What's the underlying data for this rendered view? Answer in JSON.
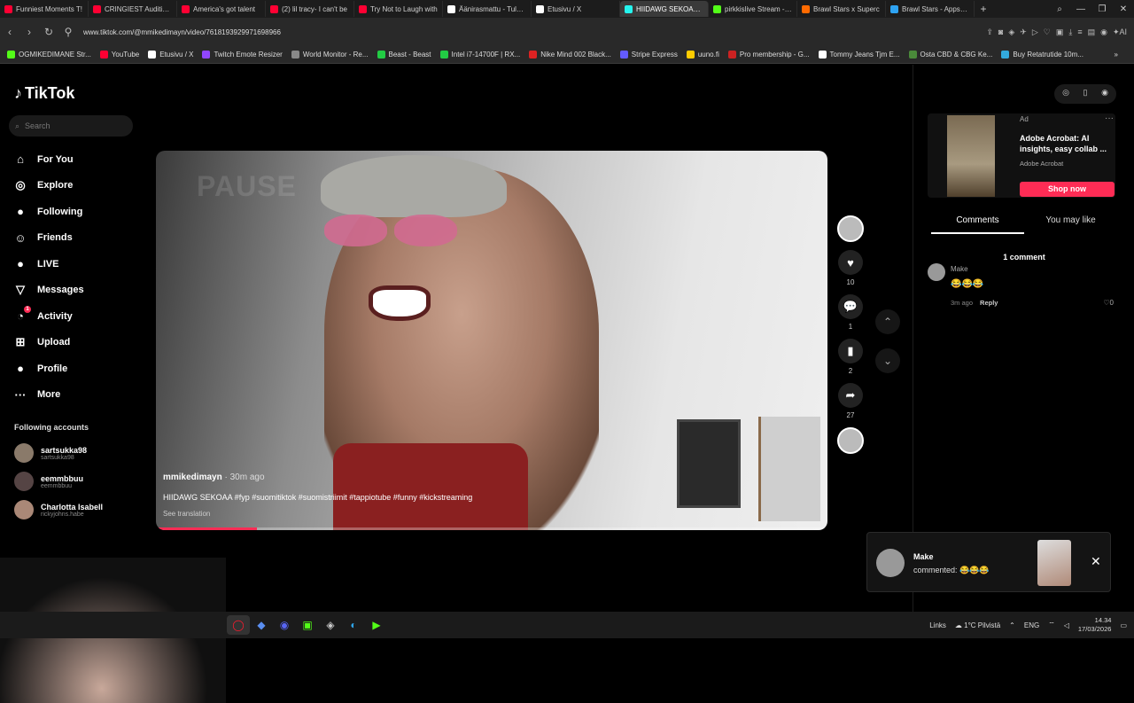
{
  "browser": {
    "tabs": [
      {
        "label": "Funniest Moments T!",
        "color": "#ff0033",
        "active": false
      },
      {
        "label": "CRINGIEST Auditions",
        "color": "#ff0033",
        "active": false
      },
      {
        "label": "America's got talent",
        "color": "#ff0033",
        "active": false
      },
      {
        "label": "(2) lil tracy- I can't be",
        "color": "#ff0033",
        "active": false
      },
      {
        "label": "Try Not to Laugh with",
        "color": "#ff0033",
        "active": false
      },
      {
        "label": "Äänirasmattu - Tule u",
        "color": "#ffffff",
        "active": false
      },
      {
        "label": "Etusivu / X",
        "color": "#ffffff",
        "active": false
      },
      {
        "label": "HIIDAWG SEKOAA #",
        "color": "#25f4ee",
        "active": true
      },
      {
        "label": "pirkkislive Stream - W",
        "color": "#53fc18",
        "active": false
      },
      {
        "label": "Brawl Stars x Superc",
        "color": "#ff6a00",
        "active": false
      },
      {
        "label": "Brawl Stars - Apps on",
        "color": "#2ea3f2",
        "active": false
      }
    ],
    "url": "www.tiktok.com/@mmikedimayn/video/7618193929971698966",
    "bookmarks": [
      {
        "label": "OGMIKEDIMANE Str...",
        "color": "#53fc18"
      },
      {
        "label": "YouTube",
        "color": "#ff0033"
      },
      {
        "label": "Etusivu / X",
        "color": "#ffffff"
      },
      {
        "label": "Twitch Emote Resizer",
        "color": "#9146ff"
      },
      {
        "label": "World Monitor - Re...",
        "color": "#888888"
      },
      {
        "label": "Beast - Beast",
        "color": "#22cc44"
      },
      {
        "label": "Intel i7-14700F | RX...",
        "color": "#22cc44"
      },
      {
        "label": "Nike Mind 002 Black...",
        "color": "#dd2222"
      },
      {
        "label": "Stripe Express",
        "color": "#635bff"
      },
      {
        "label": "uuno.fi",
        "color": "#ffcc00"
      },
      {
        "label": "Pro membership - G...",
        "color": "#cc2222"
      },
      {
        "label": "Tommy Jeans Tjm E...",
        "color": "#ffffff"
      },
      {
        "label": "Osta CBD & CBG Ke...",
        "color": "#4a8a3a"
      },
      {
        "label": "Buy Retatrutide 10m...",
        "color": "#33aadd"
      }
    ]
  },
  "tiktok": {
    "logo": "TikTok",
    "search_placeholder": "Search",
    "menu": [
      {
        "label": "For You",
        "icon": "home-icon",
        "glyph": "⌂"
      },
      {
        "label": "Explore",
        "icon": "compass-icon",
        "glyph": "◎"
      },
      {
        "label": "Following",
        "icon": "following-icon",
        "glyph": "●"
      },
      {
        "label": "Friends",
        "icon": "friends-icon",
        "glyph": "☺"
      },
      {
        "label": "LIVE",
        "icon": "live-icon",
        "glyph": "●"
      },
      {
        "label": "Messages",
        "icon": "messages-icon",
        "glyph": "▽"
      },
      {
        "label": "Activity",
        "icon": "activity-icon",
        "glyph": "◔",
        "badge": "1"
      },
      {
        "label": "Upload",
        "icon": "upload-icon",
        "glyph": "⊞"
      },
      {
        "label": "Profile",
        "icon": "profile-icon",
        "glyph": "●"
      },
      {
        "label": "More",
        "icon": "more-icon",
        "glyph": "···"
      }
    ],
    "following_title": "Following accounts",
    "following": [
      {
        "name": "sartsukka98",
        "handle": "sartsukka98"
      },
      {
        "name": "eemmbbuu",
        "handle": "eemmbbuu"
      },
      {
        "name": "Charlotta Isabell",
        "handle": "rickyjohns.habe"
      }
    ],
    "video": {
      "overlay": "PAUSE",
      "author": "mmikedimayn",
      "time": "· 30m ago",
      "description": "HIIDAWG SEKOAA #fyp #suomitiktok #suomistriimit #tappiotube #funny #kickstreaming",
      "translation": "See translation",
      "progress": 0.15
    },
    "actions": {
      "likes": "10",
      "comments": "1",
      "saves": "2",
      "shares": "27"
    },
    "ad": {
      "tag": "Ad",
      "title": "Adobe Acrobat: AI insights, easy collab ...",
      "sponsor": "Adobe Acrobat",
      "cta": "Shop now"
    },
    "tabs": {
      "comments": "Comments",
      "may_like": "You may like"
    },
    "comment_count": "1 comment",
    "comment": {
      "name": "Make",
      "text": "😂😂😂",
      "age": "3m ago",
      "reply": "Reply",
      "likes": "0"
    },
    "notification": {
      "name": "Make",
      "text": "commented: 😂😂😂"
    }
  },
  "taskbar": {
    "links": "Links",
    "weather": "1°C Pilvistä",
    "lang": "ENG",
    "time": "14.34",
    "date": "17/03/2026"
  }
}
